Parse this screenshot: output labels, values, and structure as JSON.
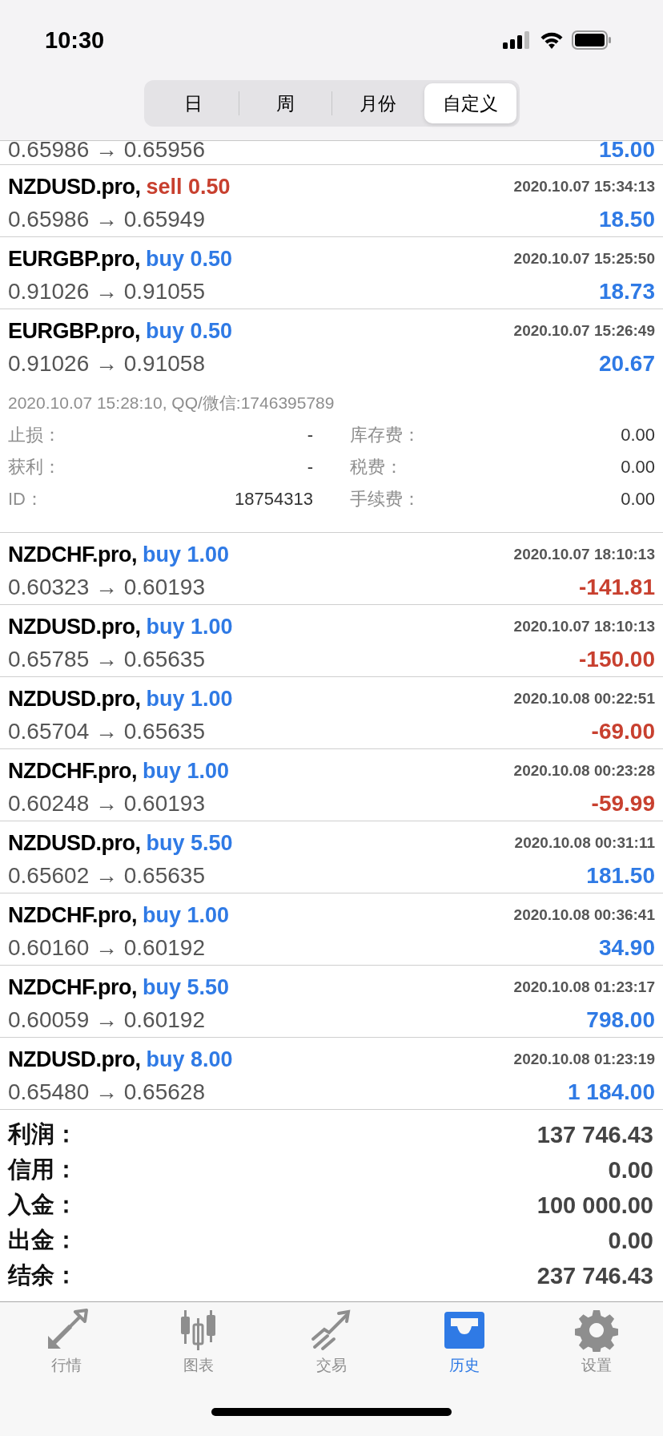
{
  "status_bar": {
    "time": "10:30"
  },
  "period_tabs": [
    {
      "label": "日",
      "selected": false
    },
    {
      "label": "周",
      "selected": false
    },
    {
      "label": "月份",
      "selected": false
    },
    {
      "label": "自定义",
      "selected": true
    }
  ],
  "partial_deal": {
    "prices": "0.65986 → 0.65956",
    "profit": {
      "text": "15.00",
      "kind": "gain"
    }
  },
  "deals": [
    {
      "symbol": "NZDUSD.pro,",
      "action": {
        "text": "sell 0.50",
        "kind": "sell"
      },
      "time": "2020.10.07 15:34:13",
      "prices": "0.65986 → 0.65949",
      "profit": {
        "text": "18.50",
        "kind": "gain"
      }
    },
    {
      "symbol": "EURGBP.pro,",
      "action": {
        "text": "buy 0.50",
        "kind": "buy"
      },
      "time": "2020.10.07 15:25:50",
      "prices": "0.91026 → 0.91055",
      "profit": {
        "text": "18.73",
        "kind": "gain"
      }
    },
    {
      "symbol": "EURGBP.pro,",
      "action": {
        "text": "buy 0.50",
        "kind": "buy"
      },
      "time": "2020.10.07 15:26:49",
      "prices": "0.91026 → 0.91058",
      "profit": {
        "text": "20.67",
        "kind": "gain"
      },
      "details": {
        "comment": "2020.10.07 15:28:10, QQ/微信:1746395789",
        "fields": [
          {
            "label": "止损：",
            "value": "-"
          },
          {
            "label": "库存费：",
            "value": "0.00"
          },
          {
            "label": "获利：",
            "value": "-"
          },
          {
            "label": "税费：",
            "value": "0.00"
          },
          {
            "label": "ID：",
            "value": "18754313"
          },
          {
            "label": "手续费：",
            "value": "0.00"
          }
        ]
      }
    },
    {
      "symbol": "NZDCHF.pro,",
      "action": {
        "text": "buy 1.00",
        "kind": "buy"
      },
      "time": "2020.10.07 18:10:13",
      "prices": "0.60323 → 0.60193",
      "profit": {
        "text": "-141.81",
        "kind": "loss"
      }
    },
    {
      "symbol": "NZDUSD.pro,",
      "action": {
        "text": "buy 1.00",
        "kind": "buy"
      },
      "time": "2020.10.07 18:10:13",
      "prices": "0.65785 → 0.65635",
      "profit": {
        "text": "-150.00",
        "kind": "loss"
      }
    },
    {
      "symbol": "NZDUSD.pro,",
      "action": {
        "text": "buy 1.00",
        "kind": "buy"
      },
      "time": "2020.10.08 00:22:51",
      "prices": "0.65704 → 0.65635",
      "profit": {
        "text": "-69.00",
        "kind": "loss"
      }
    },
    {
      "symbol": "NZDCHF.pro,",
      "action": {
        "text": "buy 1.00",
        "kind": "buy"
      },
      "time": "2020.10.08 00:23:28",
      "prices": "0.60248 → 0.60193",
      "profit": {
        "text": "-59.99",
        "kind": "loss"
      }
    },
    {
      "symbol": "NZDUSD.pro,",
      "action": {
        "text": "buy 5.50",
        "kind": "buy"
      },
      "time": "2020.10.08 00:31:11",
      "prices": "0.65602 → 0.65635",
      "profit": {
        "text": "181.50",
        "kind": "gain"
      }
    },
    {
      "symbol": "NZDCHF.pro,",
      "action": {
        "text": "buy 1.00",
        "kind": "buy"
      },
      "time": "2020.10.08 00:36:41",
      "prices": "0.60160 → 0.60192",
      "profit": {
        "text": "34.90",
        "kind": "gain"
      }
    },
    {
      "symbol": "NZDCHF.pro,",
      "action": {
        "text": "buy 5.50",
        "kind": "buy"
      },
      "time": "2020.10.08 01:23:17",
      "prices": "0.60059 → 0.60192",
      "profit": {
        "text": "798.00",
        "kind": "gain"
      }
    },
    {
      "symbol": "NZDUSD.pro,",
      "action": {
        "text": "buy 8.00",
        "kind": "buy"
      },
      "time": "2020.10.08 01:23:19",
      "prices": "0.65480 → 0.65628",
      "profit": {
        "text": "1 184.00",
        "kind": "gain"
      }
    }
  ],
  "summary": [
    {
      "label": "利润：",
      "value": "137 746.43"
    },
    {
      "label": "信用：",
      "value": "0.00"
    },
    {
      "label": "入金：",
      "value": "100 000.00"
    },
    {
      "label": "出金：",
      "value": "0.00"
    },
    {
      "label": "结余：",
      "value": "237 746.43"
    }
  ],
  "tab_bar": [
    {
      "label": "行情",
      "selected": false
    },
    {
      "label": "图表",
      "selected": false
    },
    {
      "label": "交易",
      "selected": false
    },
    {
      "label": "历史",
      "selected": true
    },
    {
      "label": "设置",
      "selected": false
    }
  ]
}
